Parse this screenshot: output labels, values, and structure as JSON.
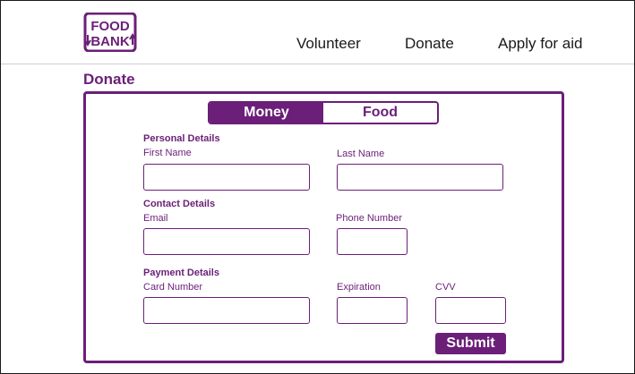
{
  "brand": {
    "logo_line1": "FOOD",
    "logo_line2": "BANK",
    "color": "#6b1f78"
  },
  "nav": {
    "items": [
      {
        "label": "Volunteer"
      },
      {
        "label": "Donate"
      },
      {
        "label": "Apply for aid"
      }
    ]
  },
  "page": {
    "title": "Donate"
  },
  "tabs": [
    {
      "label": "Money",
      "selected": true
    },
    {
      "label": "Food",
      "selected": false
    }
  ],
  "form": {
    "personal": {
      "heading": "Personal Details",
      "first_name_label": "First Name",
      "first_name_value": "",
      "last_name_label": "Last Name",
      "last_name_value": ""
    },
    "contact": {
      "heading": "Contact Details",
      "email_label": "Email",
      "email_value": "",
      "phone_label": "Phone Number",
      "phone_value": ""
    },
    "payment": {
      "heading": "Payment Details",
      "card_label": "Card Number",
      "card_value": "",
      "expiration_label": "Expiration",
      "expiration_value": "",
      "cvv_label": "CVV",
      "cvv_value": ""
    },
    "submit_label": "Submit"
  }
}
